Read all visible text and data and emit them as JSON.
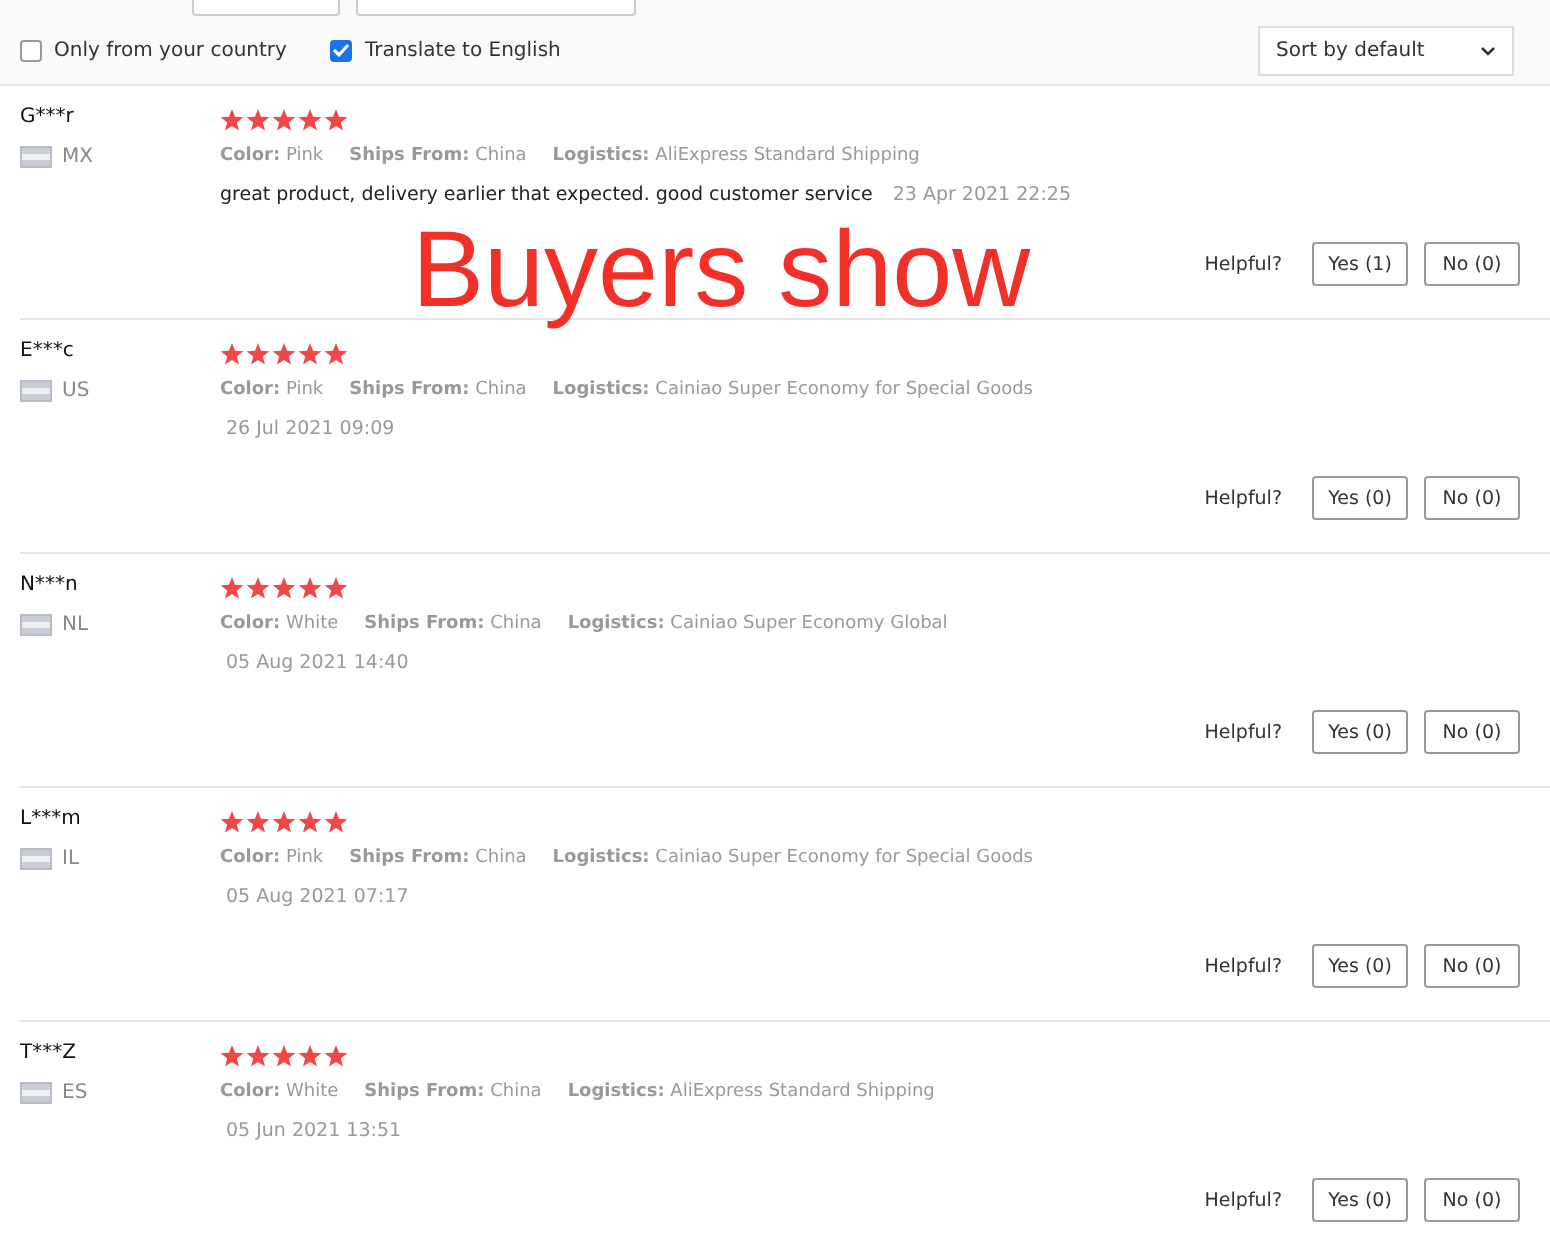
{
  "filters": {
    "only_country": {
      "label": "Only from your country",
      "checked": false
    },
    "translate": {
      "label": "Translate to English",
      "checked": true
    },
    "sort": {
      "value": "Sort by default"
    }
  },
  "overlay_caption": "Buyers show",
  "reviews": [
    {
      "name": "G***r",
      "country": "MX",
      "stars": 5,
      "attributes": [
        {
          "label": "Color:",
          "value": "Pink"
        },
        {
          "label": "Ships From:",
          "value": "China"
        },
        {
          "label": "Logistics:",
          "value": "AliExpress Standard Shipping"
        }
      ],
      "comment": "great product, delivery earlier that expected. good customer service",
      "date": "23 Apr 2021 22:25",
      "helpful_label": "Helpful?",
      "yes": "Yes (1)",
      "no": "No (0)"
    },
    {
      "name": "E***c",
      "country": "US",
      "stars": 5,
      "attributes": [
        {
          "label": "Color:",
          "value": "Pink"
        },
        {
          "label": "Ships From:",
          "value": "China"
        },
        {
          "label": "Logistics:",
          "value": "Cainiao Super Economy for Special Goods"
        }
      ],
      "date": "26 Jul 2021 09:09",
      "helpful_label": "Helpful?",
      "yes": "Yes (0)",
      "no": "No (0)"
    },
    {
      "name": "N***n",
      "country": "NL",
      "stars": 5,
      "attributes": [
        {
          "label": "Color:",
          "value": "White"
        },
        {
          "label": "Ships From:",
          "value": "China"
        },
        {
          "label": "Logistics:",
          "value": "Cainiao Super Economy Global"
        }
      ],
      "date": "05 Aug 2021 14:40",
      "helpful_label": "Helpful?",
      "yes": "Yes (0)",
      "no": "No (0)"
    },
    {
      "name": "L***m",
      "country": "IL",
      "stars": 5,
      "attributes": [
        {
          "label": "Color:",
          "value": "Pink"
        },
        {
          "label": "Ships From:",
          "value": "China"
        },
        {
          "label": "Logistics:",
          "value": "Cainiao Super Economy for Special Goods"
        }
      ],
      "date": "05 Aug 2021 07:17",
      "helpful_label": "Helpful?",
      "yes": "Yes (0)",
      "no": "No (0)"
    },
    {
      "name": "T***Z",
      "country": "ES",
      "stars": 5,
      "attributes": [
        {
          "label": "Color:",
          "value": "White"
        },
        {
          "label": "Ships From:",
          "value": "China"
        },
        {
          "label": "Logistics:",
          "value": "AliExpress Standard Shipping"
        }
      ],
      "date": "05 Jun 2021 13:51",
      "helpful_label": "Helpful?",
      "yes": "Yes (0)",
      "no": "No (0)"
    }
  ]
}
